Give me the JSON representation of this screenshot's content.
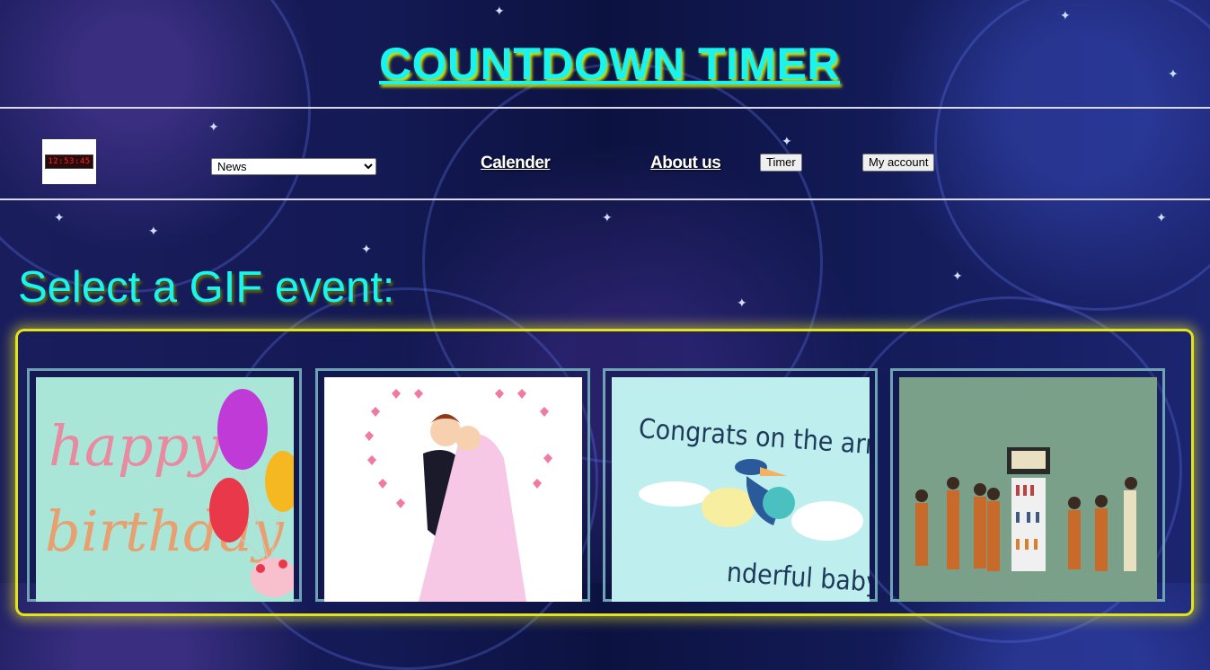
{
  "header": {
    "title": "COUNTDOWN TIMER"
  },
  "nav": {
    "logo_clock_text": "12:53:45",
    "select": {
      "selected": "News",
      "options": [
        "News"
      ]
    },
    "links": [
      {
        "label": "Calender"
      },
      {
        "label": "About us"
      }
    ],
    "buttons": [
      {
        "label": "Timer"
      },
      {
        "label": "My account"
      }
    ]
  },
  "main": {
    "heading": "Select a GIF event:",
    "gifs": [
      {
        "caption_lines": [
          "happy",
          "birthday"
        ]
      },
      {
        "caption_lines": []
      },
      {
        "caption_lines": [
          "Congrats on the arrival",
          "nderful baby"
        ]
      },
      {
        "caption_lines": []
      }
    ]
  },
  "colors": {
    "accent_cyan": "#19f5ee",
    "gallery_border": "#e3e31a",
    "card_border": "#6da3b5"
  }
}
